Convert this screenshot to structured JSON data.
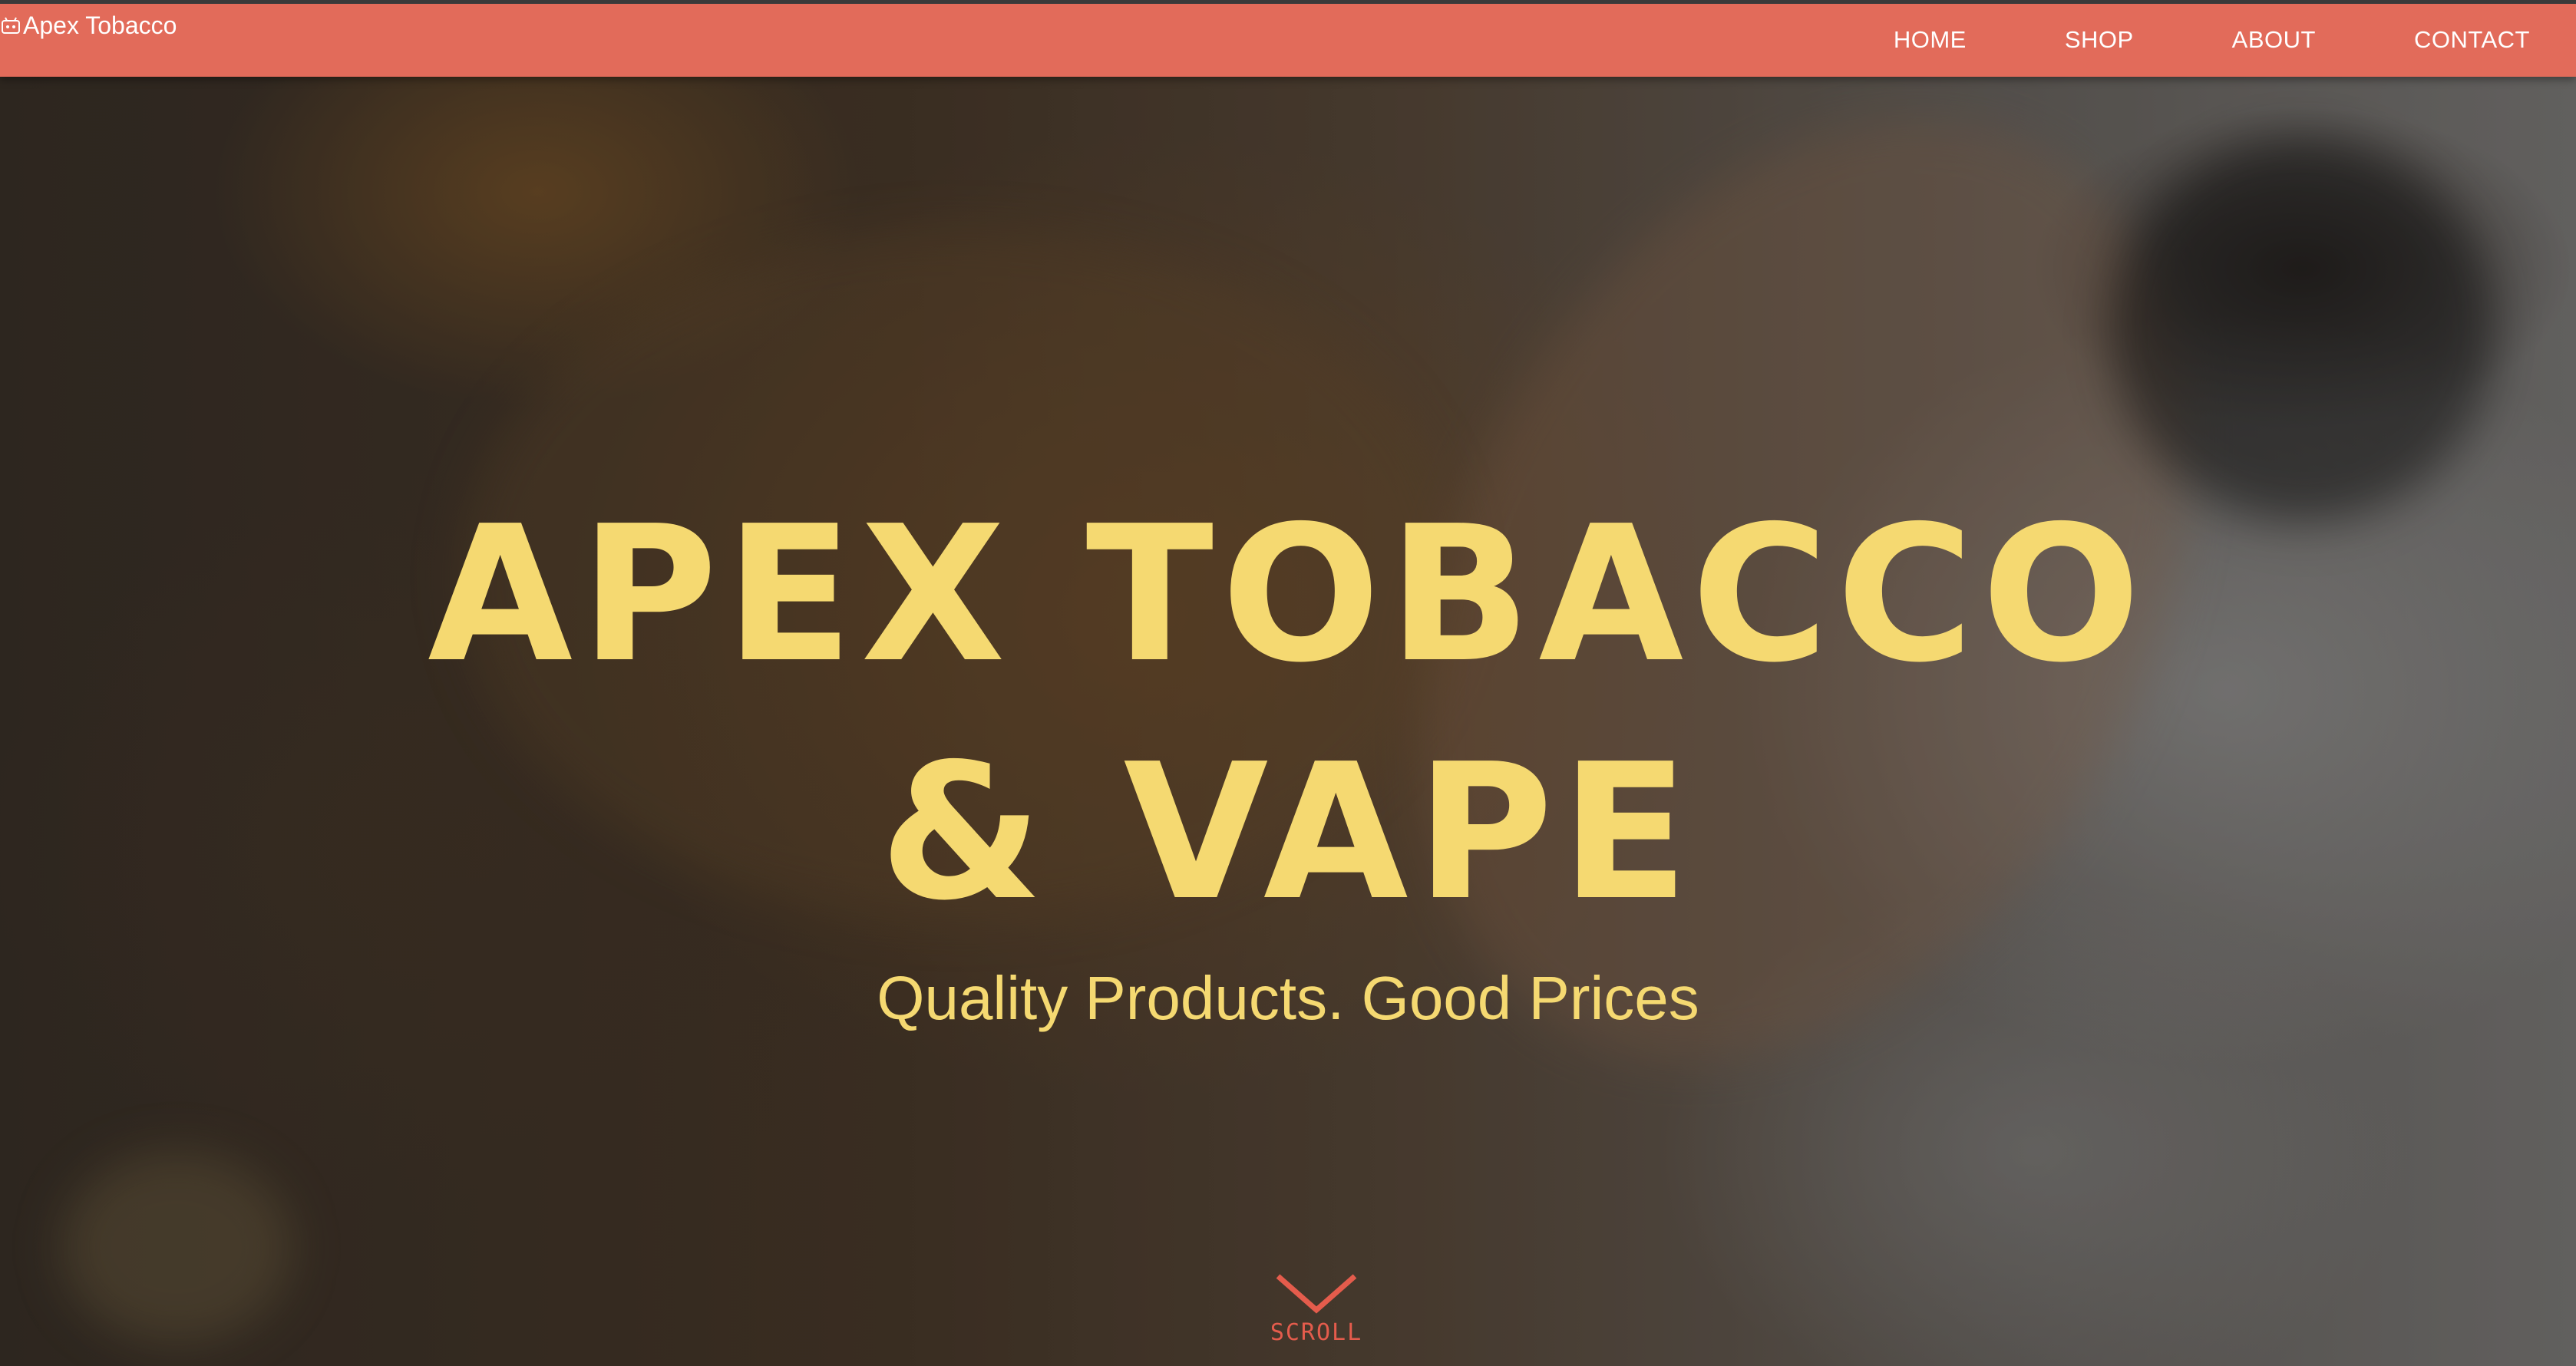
{
  "header": {
    "brand_name": "Apex Tobacco",
    "brand_icon": "broken-image-icon",
    "background_color": "#e26b5a",
    "nav": [
      {
        "label": "HOME"
      },
      {
        "label": "SHOP"
      },
      {
        "label": "ABOUT"
      },
      {
        "label": "CONTACT"
      }
    ]
  },
  "hero": {
    "title_line1": "APEX TOBACCO",
    "title_line2": "& VAPE",
    "subtitle": "Quality Products. Good Prices",
    "text_color": "#f5d971"
  },
  "scroll": {
    "label": "SCROLL",
    "icon": "chevron-down-icon",
    "color": "#e45c4c"
  }
}
